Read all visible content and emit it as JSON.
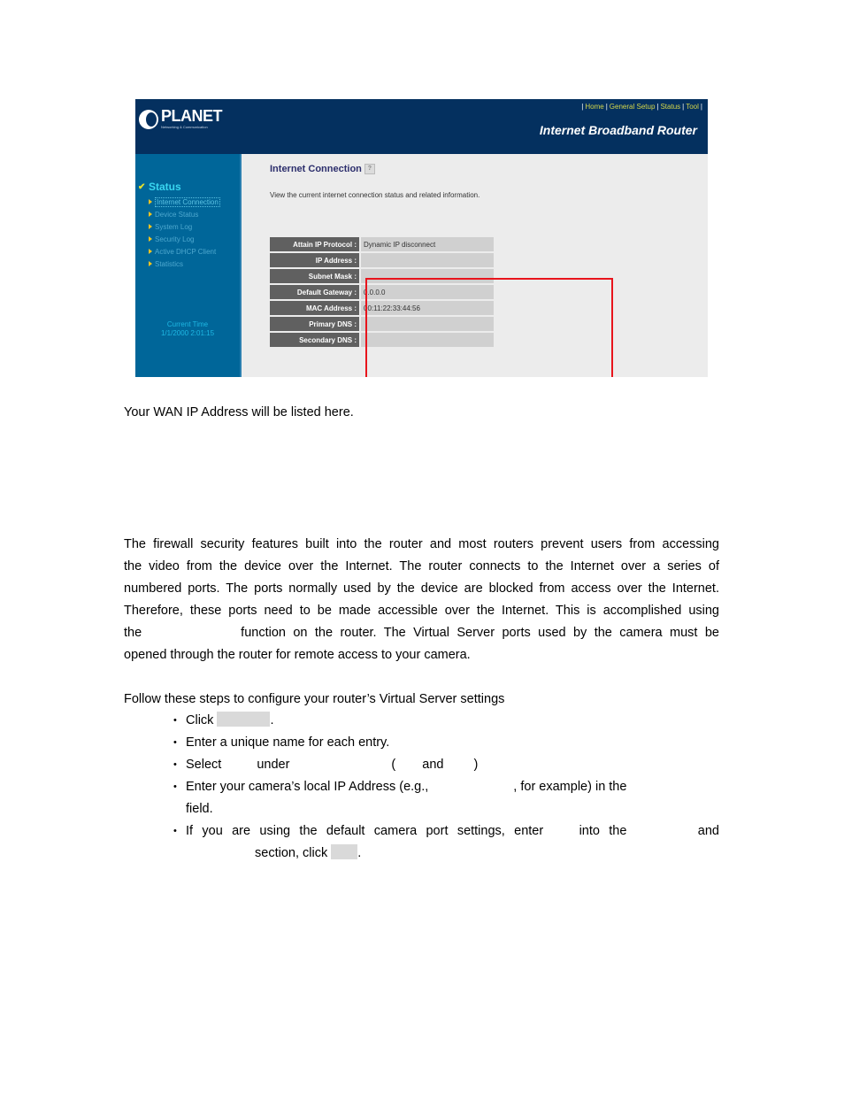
{
  "router_ui": {
    "logo": {
      "name": "PLANET",
      "tagline": "Networking & Communication"
    },
    "top_nav": [
      "Home",
      "General Setup",
      "Status",
      "Tool"
    ],
    "product_title": "Internet Broadband Router",
    "sidebar": {
      "section": "Status",
      "items": [
        {
          "label": "Internet Connection",
          "active": true
        },
        {
          "label": "Device Status",
          "active": false
        },
        {
          "label": "System Log",
          "active": false
        },
        {
          "label": "Security Log",
          "active": false
        },
        {
          "label": "Active DHCP Client",
          "active": false
        },
        {
          "label": "Statistics",
          "active": false
        }
      ],
      "clock_label": "Current Time",
      "clock_value": "1/1/2000 2:01:15"
    },
    "content": {
      "title": "Internet Connection",
      "description": "View the current internet connection status and related information.",
      "rows": [
        {
          "label": "Attain IP Protocol :",
          "value": "Dynamic IP disconnect"
        },
        {
          "label": "IP Address :",
          "value": ""
        },
        {
          "label": "Subnet Mask :",
          "value": ""
        },
        {
          "label": "Default Gateway :",
          "value": "0.0.0.0"
        },
        {
          "label": "MAC Address :",
          "value": "00:11:22:33:44:56"
        },
        {
          "label": "Primary DNS :",
          "value": ""
        },
        {
          "label": "Secondary DNS :",
          "value": ""
        }
      ]
    },
    "colors": {
      "header_bg": "#04305f",
      "sidebar_bg": "#006699",
      "content_bg": "#ececec",
      "label_cell": "#606060",
      "value_cell": "#d0d0d0",
      "highlight": "#e8141c",
      "nav_link": "#d4d64a"
    }
  },
  "document": {
    "caption": "Your WAN IP Address will be listed here.",
    "paragraph_lines": [
      "The firewall security features built into the router and most routers prevent users from accessing",
      "the video from the device over the Internet. The router connects to the Internet over a series of",
      "numbered ports. The ports normally used by the device are blocked from access over the Internet.",
      "Therefore, these ports need to be made accessible over the Internet. This is accomplished using",
      [
        "the",
        "function on the router. The Virtual Server ports used by the camera must be"
      ],
      "opened through the router for remote access to your camera."
    ],
    "steps_intro": "Follow these steps to configure your router’s Virtual Server settings",
    "steps": {
      "s1_a": "Click",
      "s1_b": ".",
      "s2": "Enter a unique name for each entry.",
      "s3_a": "Select",
      "s3_b": "under",
      "s3_c": "(",
      "s3_d": "and",
      "s3_e": ")",
      "s4_a": "Enter your camera’s local IP Address (e.g.,",
      "s4_b": ", for example) in the",
      "s4_c": "field.",
      "s5_a": "If you are using the default camera port settings, enter",
      "s5_b": "into the",
      "s5_c": "and",
      "s5_d": "section, click",
      "s5_e": "."
    }
  }
}
